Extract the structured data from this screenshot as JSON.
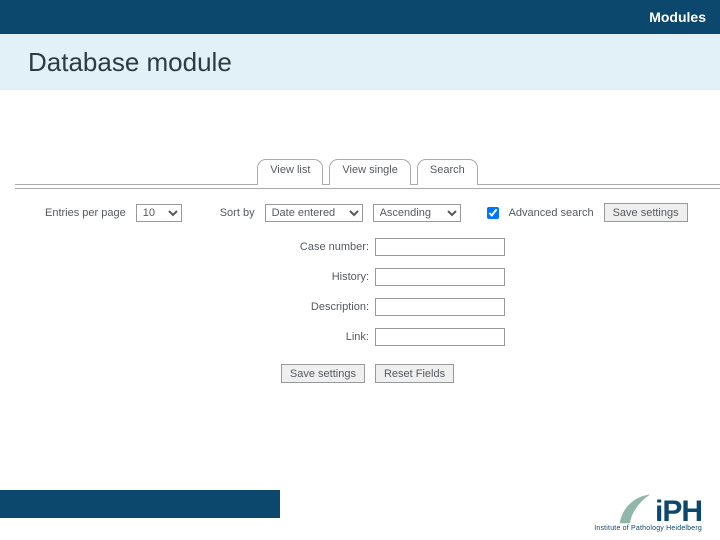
{
  "header": {
    "section": "Modules",
    "title": "Database module"
  },
  "tabs": {
    "view_list": "View list",
    "view_single": "View single",
    "search": "Search"
  },
  "controls": {
    "entries_label": "Entries per page",
    "entries_value": "10",
    "sort_label": "Sort by",
    "sort_value": "Date entered",
    "order_value": "Ascending",
    "adv_label": "Advanced search",
    "save_label": "Save settings"
  },
  "fields": {
    "case_number": "Case number:",
    "history": "History:",
    "description": "Description:",
    "link": "Link:"
  },
  "buttons": {
    "save": "Save settings",
    "reset": "Reset Fields"
  },
  "logo": {
    "text": "iPH",
    "caption": "Institute of Pathology Heidelberg"
  }
}
